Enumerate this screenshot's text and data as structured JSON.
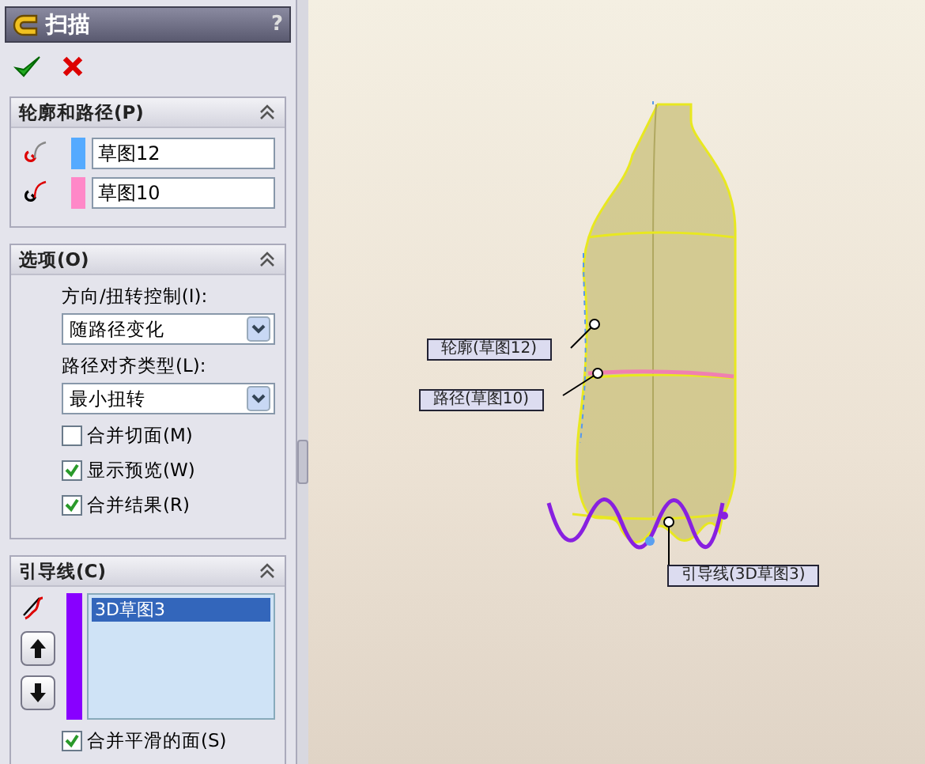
{
  "panel": {
    "title": "扫描",
    "help": "?",
    "profile_path": {
      "title": "轮廓和路径(P)",
      "expanded": true,
      "items": [
        {
          "kind": "profile",
          "value": "草图12",
          "color": "#55aaff"
        },
        {
          "kind": "path",
          "value": "草图10",
          "color": "#ff88c8"
        }
      ]
    },
    "options": {
      "title": "选项(O)",
      "expanded": true,
      "dropdowns": [
        {
          "label": "方向/扭转控制(I):",
          "value": "随路径变化"
        },
        {
          "label": "路径对齐类型(L):",
          "value": "最小扭转"
        }
      ],
      "checkboxes": [
        {
          "label": "合并切面(M)",
          "checked": false
        },
        {
          "label": "显示预览(W)",
          "checked": true
        },
        {
          "label": "合并结果(R)",
          "checked": true
        }
      ]
    },
    "guides": {
      "title": "引导线(C)",
      "expanded": true,
      "color": "#8800ff",
      "items": [
        {
          "text": "3D草图3",
          "selected": true
        }
      ],
      "checkbox": {
        "label": "合并平滑的面(S)",
        "checked": true
      }
    }
  },
  "viewport": {
    "callouts": [
      {
        "text": "轮廓(草图12)"
      },
      {
        "text": "路径(草图10)"
      },
      {
        "text": "引导线(3D草图3)"
      }
    ]
  }
}
